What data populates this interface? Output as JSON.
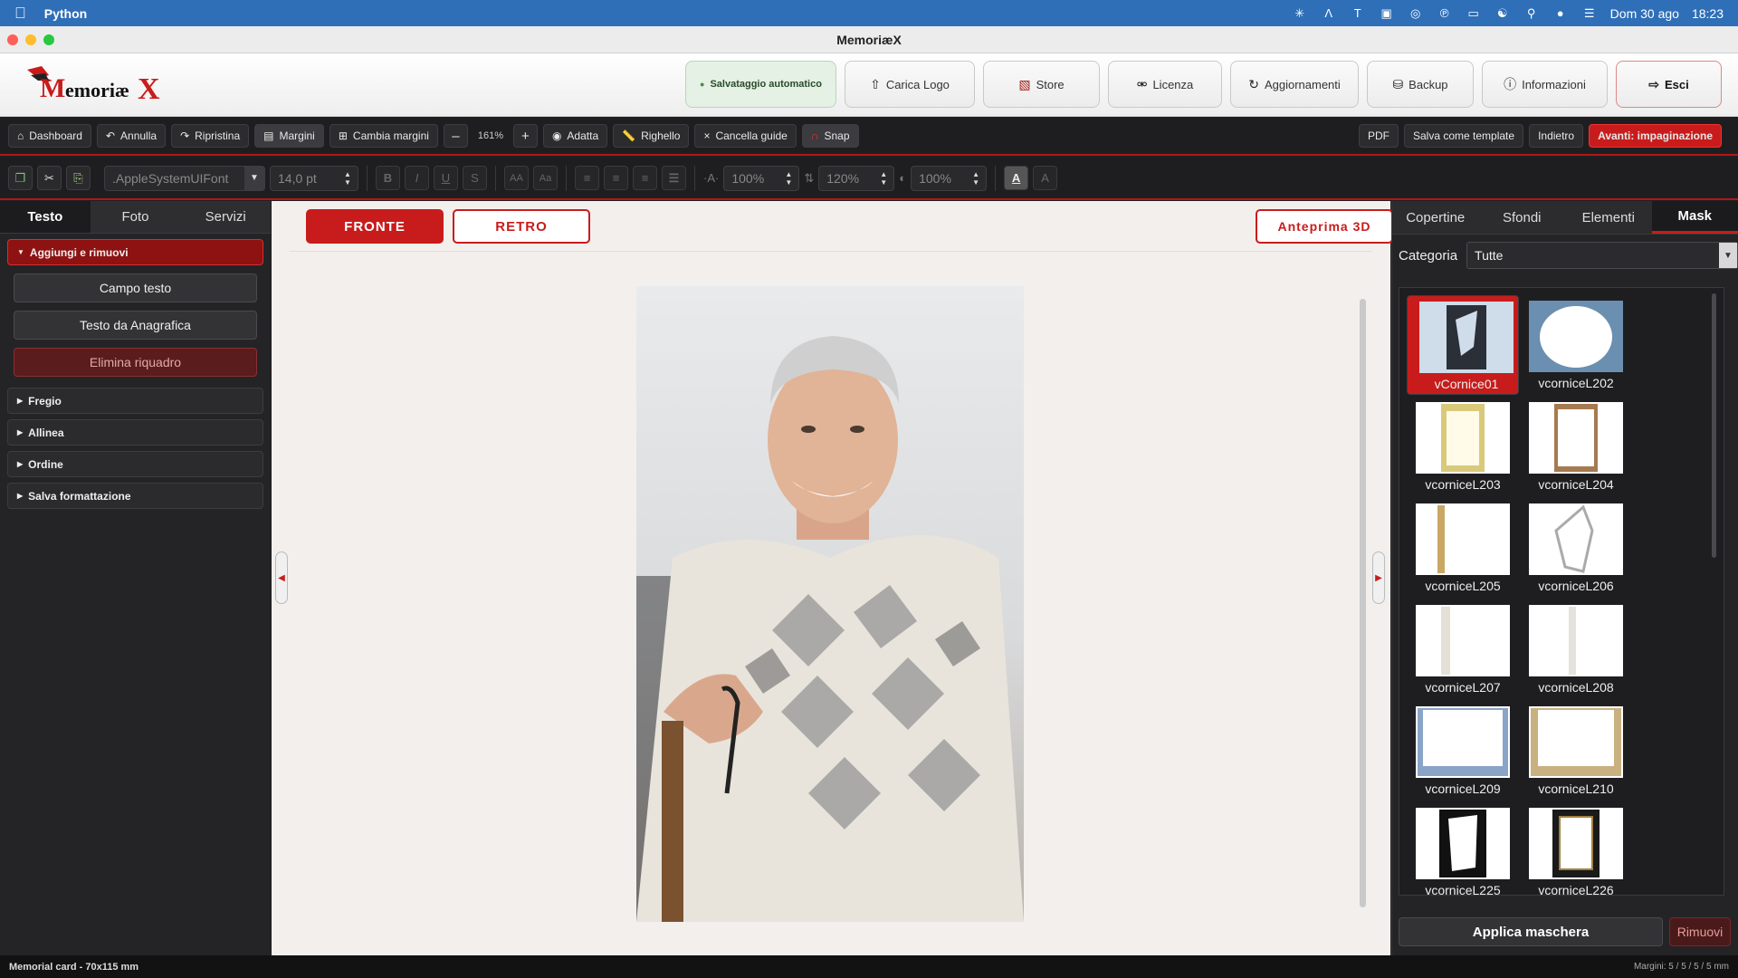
{
  "menubar": {
    "app_name": "Python",
    "date": "Dom 30 ago",
    "time": "18:23"
  },
  "window": {
    "title": "MemoriæX"
  },
  "header": {
    "autosave": "Salvataggio automatico",
    "buttons": {
      "logo": "Carica Logo",
      "store": "Store",
      "license": "Licenza",
      "updates": "Aggiornamenti",
      "backup": "Backup",
      "info": "Informazioni",
      "exit": "Esci"
    }
  },
  "toolbar1": {
    "dashboard": "Dashboard",
    "undo": "Annulla",
    "redo": "Ripristina",
    "margins": "Margini",
    "change_margins": "Cambia margini",
    "zoom_minus": "–",
    "zoom": "161%",
    "zoom_plus": "+",
    "fit": "Adatta",
    "ruler": "Righello",
    "clear_guides": "Cancella guide",
    "snap": "Snap",
    "pdf": "PDF",
    "save_template": "Salva come template",
    "back": "Indietro",
    "next": "Avanti: impaginazione"
  },
  "toolbar2": {
    "font": ".AppleSystemUIFont",
    "font_size": "14,0 pt",
    "scale_x": "100%",
    "line_height": "120%",
    "scale_y": "100%"
  },
  "left_panel": {
    "tabs": [
      "Testo",
      "Foto",
      "Servizi"
    ],
    "sections": {
      "add_remove": "Aggiungi e rimuovi",
      "fregio": "Fregio",
      "allinea": "Allinea",
      "ordine": "Ordine",
      "salva": "Salva formattazione"
    },
    "buttons": {
      "text_field": "Campo testo",
      "registry_text": "Testo da Anagrafica",
      "delete_box": "Elimina riquadro"
    }
  },
  "canvas": {
    "front": "FRONTE",
    "back": "RETRO",
    "preview": "Anteprima 3D"
  },
  "right_panel": {
    "tabs": [
      "Copertine",
      "Sfondi",
      "Elementi",
      "Mask"
    ],
    "category_label": "Categoria",
    "category_value": "Tutte",
    "masks": [
      "vCornice01",
      "vcorniceL202",
      "vcorniceL203",
      "vcorniceL204",
      "vcorniceL205",
      "vcorniceL206",
      "vcorniceL207",
      "vcorniceL208",
      "vcorniceL209",
      "vcorniceL210",
      "vcorniceL225",
      "vcorniceL226"
    ],
    "apply": "Applica maschera",
    "remove": "Rimuovi"
  },
  "status": {
    "left": "Memorial card - 70x115 mm",
    "right": "Margini: 5 / 5 / 5 / 5 mm"
  },
  "colors": {
    "accent": "#c81c1c",
    "menubar": "#2f6fb8"
  }
}
